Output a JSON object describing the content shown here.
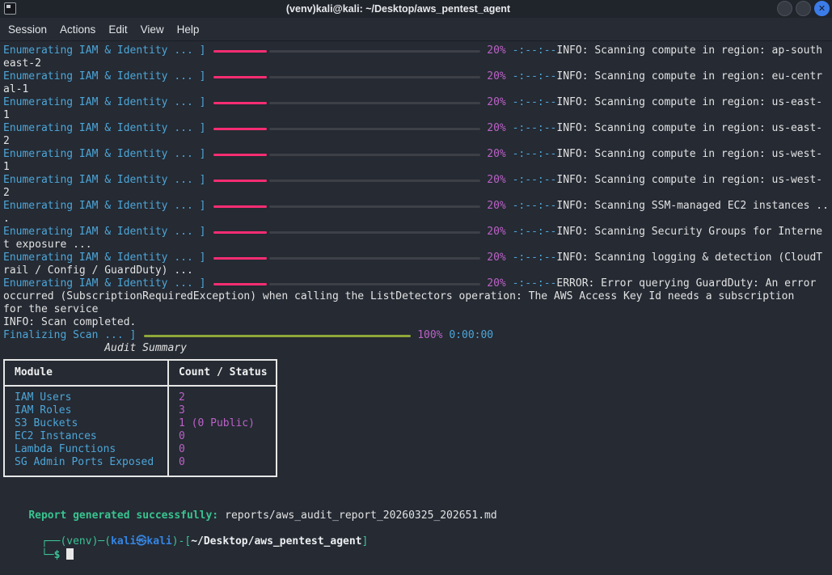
{
  "window": {
    "title": "(venv)kali@kali: ~/Desktop/aws_pentest_agent",
    "menu": [
      "Session",
      "Actions",
      "Edit",
      "View",
      "Help"
    ],
    "controls": {
      "close_glyph": "✕"
    }
  },
  "colors": {
    "background": "#252a33",
    "titlebar": "#20242b",
    "accent_pink": "#f92d72",
    "bar_track": "#3d4047",
    "accent_green": "#8fa839",
    "cyan": "#4da6d8",
    "magenta": "#bc62c6",
    "text": "#e2e2e2",
    "success_green": "#38c48f",
    "prompt_teal": "#3cc295",
    "prompt_blue": "#3585e2",
    "close_blue": "#3b7ce8"
  },
  "terminal": {
    "lines": [
      {
        "segs": [
          {
            "t": "Enumerating IAM & Identity ... ]",
            "c": "cyan"
          },
          {
            "bar": 20,
            "color": "accent_pink"
          },
          {
            "t": " 20% ",
            "c": "mag"
          },
          {
            "t": "-:--:--",
            "c": "cyan"
          },
          {
            "t": "INFO: Scanning compute in region: ap-south",
            "c": "w"
          }
        ]
      },
      {
        "segs": [
          {
            "t": "east-2",
            "c": "w"
          }
        ]
      },
      {
        "segs": [
          {
            "t": "Enumerating IAM & Identity ... ]",
            "c": "cyan"
          },
          {
            "bar": 20,
            "color": "accent_pink"
          },
          {
            "t": " 20% ",
            "c": "mag"
          },
          {
            "t": "-:--:--",
            "c": "cyan"
          },
          {
            "t": "INFO: Scanning compute in region: eu-centr",
            "c": "w"
          }
        ]
      },
      {
        "segs": [
          {
            "t": "al-1",
            "c": "w"
          }
        ]
      },
      {
        "segs": [
          {
            "t": "Enumerating IAM & Identity ... ]",
            "c": "cyan"
          },
          {
            "bar": 20,
            "color": "accent_pink"
          },
          {
            "t": " 20% ",
            "c": "mag"
          },
          {
            "t": "-:--:--",
            "c": "cyan"
          },
          {
            "t": "INFO: Scanning compute in region: us-east-",
            "c": "w"
          }
        ]
      },
      {
        "segs": [
          {
            "t": "1",
            "c": "w"
          }
        ]
      },
      {
        "segs": [
          {
            "t": "Enumerating IAM & Identity ... ]",
            "c": "cyan"
          },
          {
            "bar": 20,
            "color": "accent_pink"
          },
          {
            "t": " 20% ",
            "c": "mag"
          },
          {
            "t": "-:--:--",
            "c": "cyan"
          },
          {
            "t": "INFO: Scanning compute in region: us-east-",
            "c": "w"
          }
        ]
      },
      {
        "segs": [
          {
            "t": "2",
            "c": "w"
          }
        ]
      },
      {
        "segs": [
          {
            "t": "Enumerating IAM & Identity ... ]",
            "c": "cyan"
          },
          {
            "bar": 20,
            "color": "accent_pink"
          },
          {
            "t": " 20% ",
            "c": "mag"
          },
          {
            "t": "-:--:--",
            "c": "cyan"
          },
          {
            "t": "INFO: Scanning compute in region: us-west-",
            "c": "w"
          }
        ]
      },
      {
        "segs": [
          {
            "t": "1",
            "c": "w"
          }
        ]
      },
      {
        "segs": [
          {
            "t": "Enumerating IAM & Identity ... ]",
            "c": "cyan"
          },
          {
            "bar": 20,
            "color": "accent_pink"
          },
          {
            "t": " 20% ",
            "c": "mag"
          },
          {
            "t": "-:--:--",
            "c": "cyan"
          },
          {
            "t": "INFO: Scanning compute in region: us-west-",
            "c": "w"
          }
        ]
      },
      {
        "segs": [
          {
            "t": "2",
            "c": "w"
          }
        ]
      },
      {
        "segs": [
          {
            "t": "Enumerating IAM & Identity ... ]",
            "c": "cyan"
          },
          {
            "bar": 20,
            "color": "accent_pink"
          },
          {
            "t": " 20% ",
            "c": "mag"
          },
          {
            "t": "-:--:--",
            "c": "cyan"
          },
          {
            "t": "INFO: Scanning SSM-managed EC2 instances ..",
            "c": "w"
          }
        ]
      },
      {
        "segs": [
          {
            "t": ".",
            "c": "w"
          }
        ]
      },
      {
        "segs": [
          {
            "t": "Enumerating IAM & Identity ... ]",
            "c": "cyan"
          },
          {
            "bar": 20,
            "color": "accent_pink"
          },
          {
            "t": " 20% ",
            "c": "mag"
          },
          {
            "t": "-:--:--",
            "c": "cyan"
          },
          {
            "t": "INFO: Scanning Security Groups for Interne",
            "c": "w"
          }
        ]
      },
      {
        "segs": [
          {
            "t": "t exposure ...",
            "c": "w"
          }
        ]
      },
      {
        "segs": [
          {
            "t": "Enumerating IAM & Identity ... ]",
            "c": "cyan"
          },
          {
            "bar": 20,
            "color": "accent_pink"
          },
          {
            "t": " 20% ",
            "c": "mag"
          },
          {
            "t": "-:--:--",
            "c": "cyan"
          },
          {
            "t": "INFO: Scanning logging & detection (CloudT",
            "c": "w"
          }
        ]
      },
      {
        "segs": [
          {
            "t": "rail / Config / GuardDuty) ...",
            "c": "w"
          }
        ]
      },
      {
        "segs": [
          {
            "t": "Enumerating IAM & Identity ... ]",
            "c": "cyan"
          },
          {
            "bar": 20,
            "color": "accent_pink"
          },
          {
            "t": " 20% ",
            "c": "mag"
          },
          {
            "t": "-:--:--",
            "c": "cyan"
          },
          {
            "t": "ERROR: Error querying GuardDuty: An error",
            "c": "w"
          }
        ]
      },
      {
        "segs": [
          {
            "t": "occurred (SubscriptionRequiredException) when calling the ListDetectors operation: The AWS Access Key Id needs a subscription",
            "c": "w"
          }
        ]
      },
      {
        "segs": [
          {
            "t": "for the service",
            "c": "w"
          }
        ]
      },
      {
        "segs": [
          {
            "t": "INFO: Scan completed.",
            "c": "w"
          }
        ]
      },
      {
        "segs": [
          {
            "t": "Finalizing Scan ... ]",
            "c": "cyan"
          },
          {
            "bar": 100,
            "color": "accent_green"
          },
          {
            "t": " 100% ",
            "c": "mag"
          },
          {
            "t": "0:00:00",
            "c": "cyan"
          }
        ]
      },
      {
        "segs": [
          {
            "t": "                Audit Summary",
            "c": "w ital"
          }
        ]
      }
    ]
  },
  "table": {
    "headers": [
      "Module",
      "Count / Status"
    ],
    "rows": [
      {
        "module": "IAM Users",
        "count": "2"
      },
      {
        "module": "IAM Roles",
        "count": "3"
      },
      {
        "module": "S3 Buckets",
        "count": "1 (0 Public)"
      },
      {
        "module": "EC2 Instances",
        "count": "0"
      },
      {
        "module": "Lambda Functions",
        "count": "0"
      },
      {
        "module": "SG Admin Ports Exposed",
        "count": "0"
      }
    ]
  },
  "report": {
    "label": "Report generated successfully:",
    "path": "reports/aws_audit_report_20260325_202651.md"
  },
  "prompt": {
    "frame_open": "┌──(",
    "venv": "venv",
    "sep1": ")─(",
    "user_host": "kali㉿kali",
    "sep2": ")-[",
    "cwd": "~/Desktop/aws_pentest_agent",
    "frame_close": "]",
    "frame_bottom": "└─",
    "symbol": "$",
    "space": " "
  }
}
